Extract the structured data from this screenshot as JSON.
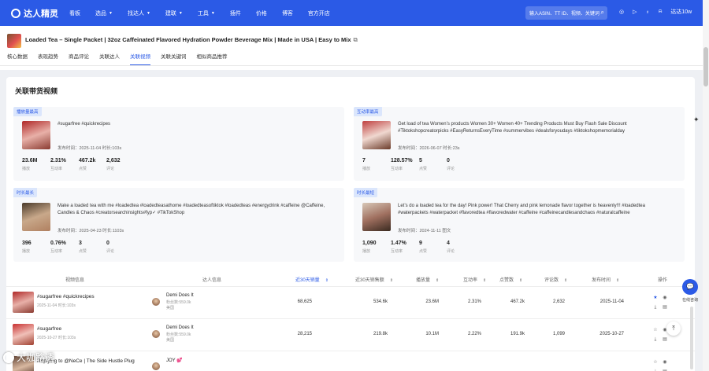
{
  "nav": {
    "logo": "达人精灵",
    "items": [
      {
        "label": "看板",
        "dropdown": false
      },
      {
        "label": "选品",
        "dropdown": true
      },
      {
        "label": "找达人",
        "dropdown": true
      },
      {
        "label": "建联",
        "dropdown": true
      },
      {
        "label": "工具",
        "dropdown": true
      },
      {
        "label": "插件",
        "dropdown": false
      },
      {
        "label": "价格",
        "dropdown": false
      },
      {
        "label": "博客",
        "dropdown": false
      },
      {
        "label": "官方开店",
        "dropdown": false
      }
    ],
    "search_placeholder": "输入ASIN、TT ID、视频、关键词",
    "user": "达达10w",
    "colors": {
      "primary": "#2b5ae6"
    }
  },
  "product": {
    "title": "Loaded Tea – Single Packet | 32oz Caffeinated Flavored Hydration Powder Beverage Mix | Made in USA | Easy to Mix",
    "external_icon": "external-link-icon"
  },
  "tabs": [
    {
      "label": "核心数据",
      "active": false
    },
    {
      "label": "表现趋势",
      "active": false
    },
    {
      "label": "商品评论",
      "active": false
    },
    {
      "label": "关联达人",
      "active": false
    },
    {
      "label": "关联视频",
      "active": true
    },
    {
      "label": "关联关键词",
      "active": false
    },
    {
      "label": "相似商品推荐",
      "active": false
    }
  ],
  "section_title": "关联带货视频",
  "cards": [
    {
      "badge": "播放量最高",
      "desc": "#sugarfree #quickrecipes",
      "meta": "发布时间：2025-11-04  时长:103s",
      "stats": [
        {
          "v": "23.6M",
          "l": "播放"
        },
        {
          "v": "2.31%",
          "l": "互动率"
        },
        {
          "v": "467.2k",
          "l": "点赞"
        },
        {
          "v": "2,632",
          "l": "评论"
        }
      ]
    },
    {
      "badge": "互动率最高",
      "desc": "Get load of tea Women’s products Women 30+ Women 40+ Trending Products Must Buy Flash Sale Discount #Tiktokshopcreatorpicks #EasyReturnsEveryTime #summervibes #dealsforyoudays #tiktokshopmemorialday",
      "meta": "发布时间：2026-06-07  时长:23s",
      "stats": [
        {
          "v": "7",
          "l": "播放"
        },
        {
          "v": "128.57%",
          "l": "互动率"
        },
        {
          "v": "5",
          "l": "点赞"
        },
        {
          "v": "0",
          "l": "评论"
        }
      ]
    },
    {
      "badge": "时长最长",
      "desc": "Make a loaded tea with me #loadedtea #loadedteasathome #loadedteasoftiktok #loadedteas #energydrink #caffeine @Caffeine, Candles & Chaos #creatorsearchinsights#fyp✓ #TikTokShop",
      "meta": "发布时间：2025-04-23  时长:1103s",
      "stats": [
        {
          "v": "396",
          "l": "播放"
        },
        {
          "v": "0.76%",
          "l": "互动率"
        },
        {
          "v": "3",
          "l": "点赞"
        },
        {
          "v": "0",
          "l": "评论"
        }
      ]
    },
    {
      "badge": "时长最短",
      "desc": "Let’s do a loaded tea for the day! Pink power! That Cherry and pink lemonade flavor together is heavenly!!! #loadedtea #waterpackets #waterpacket #flavoredtea #flavoredwater #caffeine #caffeinecandlesandchaos #naturalcaffeine",
      "meta": "发布时间：2024-11-11  图文",
      "stats": [
        {
          "v": "1,090",
          "l": "播放"
        },
        {
          "v": "1.47%",
          "l": "互动率"
        },
        {
          "v": "9",
          "l": "点赞"
        },
        {
          "v": "4",
          "l": "评论"
        }
      ]
    }
  ],
  "table": {
    "headers": [
      "视频信息",
      "达人信息",
      "近30天销量",
      "近30天销售额",
      "播放量",
      "互动率",
      "点赞数",
      "评论数",
      "发布时间",
      "操作"
    ],
    "rows": [
      {
        "title": "#sugarfree #quickrecipes",
        "meta": "2025-11-04  时长:103s",
        "influencer": "Demi Does It",
        "followers": "粉丝数:559.0k",
        "region": "美国",
        "sales30": "68,625",
        "revenue30": "534.6k",
        "views": "23.6M",
        "engagement": "2.31%",
        "likes": "467.2k",
        "comments": "2,632",
        "date": "2025-11-04"
      },
      {
        "title": "#sugarfree",
        "meta": "2025-10-27  时长:103s",
        "influencer": "Demi Does It",
        "followers": "粉丝数:559.0k",
        "region": "美国",
        "sales30": "28,215",
        "revenue30": "219.8k",
        "views": "10.1M",
        "engagement": "2.22%",
        "likes": "191.9k",
        "comments": "1,099",
        "date": "2025-10-27"
      },
      {
        "title": "Replying to @NeCe | The Side Hustle Plug",
        "meta": "",
        "influencer": "JOY 💕",
        "followers": "",
        "region": "",
        "sales30": "",
        "revenue30": "",
        "views": "",
        "engagement": "",
        "likes": "",
        "comments": "",
        "date": ""
      }
    ]
  },
  "float": {
    "chat_label": "在线咨询"
  },
  "watermark": "大咖路透"
}
